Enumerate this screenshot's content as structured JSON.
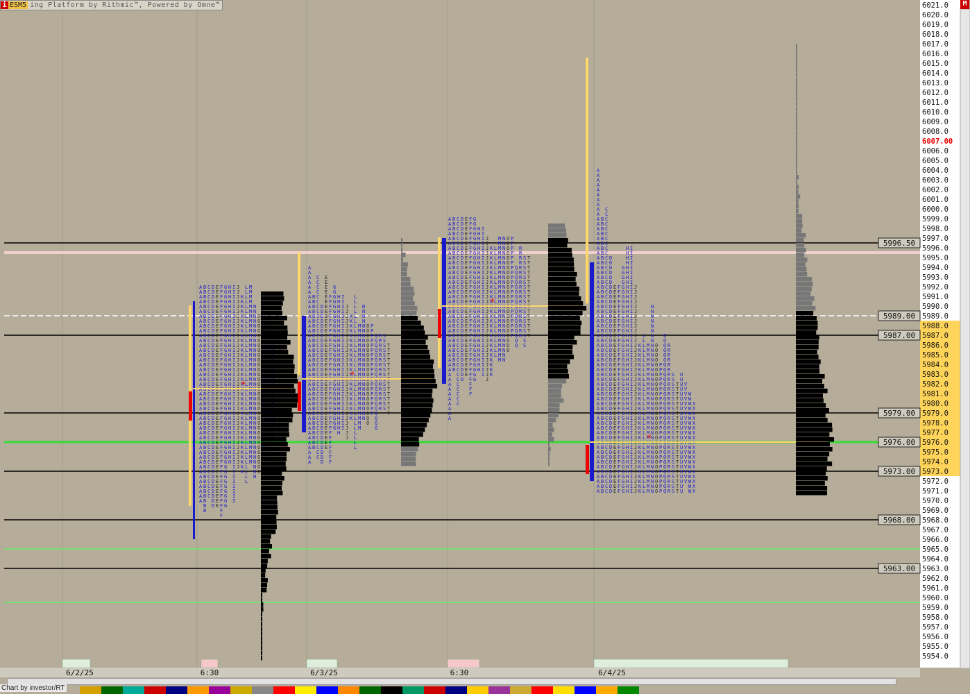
{
  "header": {
    "badge": "i",
    "symbol": "ESM5",
    "title": "ing Platform by Rithmic™, Powered by Omne™",
    "menu_badge": "M"
  },
  "footer": {
    "credit": "Chart by investor/RT"
  },
  "colors": {
    "background": "#b5ad9a",
    "tpo_blue": "#1a1acc",
    "profile_black": "#000000",
    "profile_gray": "#777777",
    "poc_yellow": "#ffd76a",
    "green_line": "#33dd33",
    "red": "#ee0000",
    "axis_bg": "#ffffff",
    "value_area_bg": "#ffd45a"
  },
  "chart_data": {
    "type": "market-profile",
    "symbol": "ESM5",
    "price_axis": {
      "min": 5954.0,
      "max": 6021.0,
      "step": 1.0,
      "ticks": [
        6021,
        6020,
        6019,
        6018,
        6017,
        6016,
        6015,
        6014,
        6013,
        6012,
        6011,
        6010,
        6009,
        6008,
        6007,
        6006,
        6005,
        6004,
        6003,
        6002,
        6001,
        6000,
        5999,
        5998,
        5997,
        5996,
        5995,
        5994,
        5993,
        5992,
        5991,
        5990,
        5989,
        5988,
        5987,
        5986,
        5985,
        5984,
        5983,
        5982,
        5981,
        5980,
        5979,
        5978,
        5977,
        5976,
        5975,
        5974,
        5973,
        5972,
        5971,
        5970,
        5969,
        5968,
        5967,
        5966,
        5965,
        5964,
        5963,
        5962,
        5961,
        5960,
        5959,
        5958,
        5957,
        5956,
        5955,
        5954
      ],
      "current_price": 6007.0,
      "value_area": [
        5973.0,
        5988.0
      ]
    },
    "x_labels": [
      "6/2/25",
      "6:30",
      "6/3/25",
      "6:30",
      "6/4/25"
    ],
    "reference_lines": [
      {
        "price": 5996.5,
        "label": "5996.50",
        "style": "solid",
        "color": "#000000"
      },
      {
        "price": 5995.5,
        "label": "",
        "style": "solid",
        "color": "#f3d0d0"
      },
      {
        "price": 5989.0,
        "label": "5989.00",
        "style": "dashed",
        "color": "#ffffff"
      },
      {
        "price": 5987.0,
        "label": "5987.00",
        "style": "solid",
        "color": "#000000"
      },
      {
        "price": 5979.0,
        "label": "5979.00",
        "style": "solid",
        "color": "#000000"
      },
      {
        "price": 5976.0,
        "label": "5976.00",
        "style": "solid",
        "color": "#33dd33"
      },
      {
        "price": 5973.0,
        "label": "5973.00",
        "style": "solid",
        "color": "#000000"
      },
      {
        "price": 5968.0,
        "label": "5968.00",
        "style": "solid",
        "color": "#000000"
      },
      {
        "price": 5965.0,
        "label": "",
        "style": "solid",
        "color": "#66ee66"
      },
      {
        "price": 5963.0,
        "label": "5963.00",
        "style": "solid",
        "color": "#000000"
      },
      {
        "price": 5959.5,
        "label": "",
        "style": "solid",
        "color": "#66ee66"
      }
    ],
    "sessions": [
      {
        "date": "6/2/25",
        "high": 5991.5,
        "low": 5954.0,
        "poc": 5981.5,
        "initial_balance": [
          5966.0,
          5990.5
        ]
      },
      {
        "date": "6/3/25",
        "high": 5997.0,
        "low": 5974.0,
        "poc": 5982.5,
        "initial_balance": [
          5977.0,
          5989.0
        ]
      },
      {
        "date": "6/3/25 6:30",
        "high": 5998.5,
        "low": 5974.0,
        "poc": 5990.0,
        "initial_balance": [
          5982.0,
          5997.0
        ]
      },
      {
        "date": "6/4/25",
        "high": 6017.0,
        "low": 5971.0,
        "poc": 5976.0,
        "initial_balance": [
          5972.0,
          5994.5
        ]
      }
    ],
    "grid": false
  }
}
